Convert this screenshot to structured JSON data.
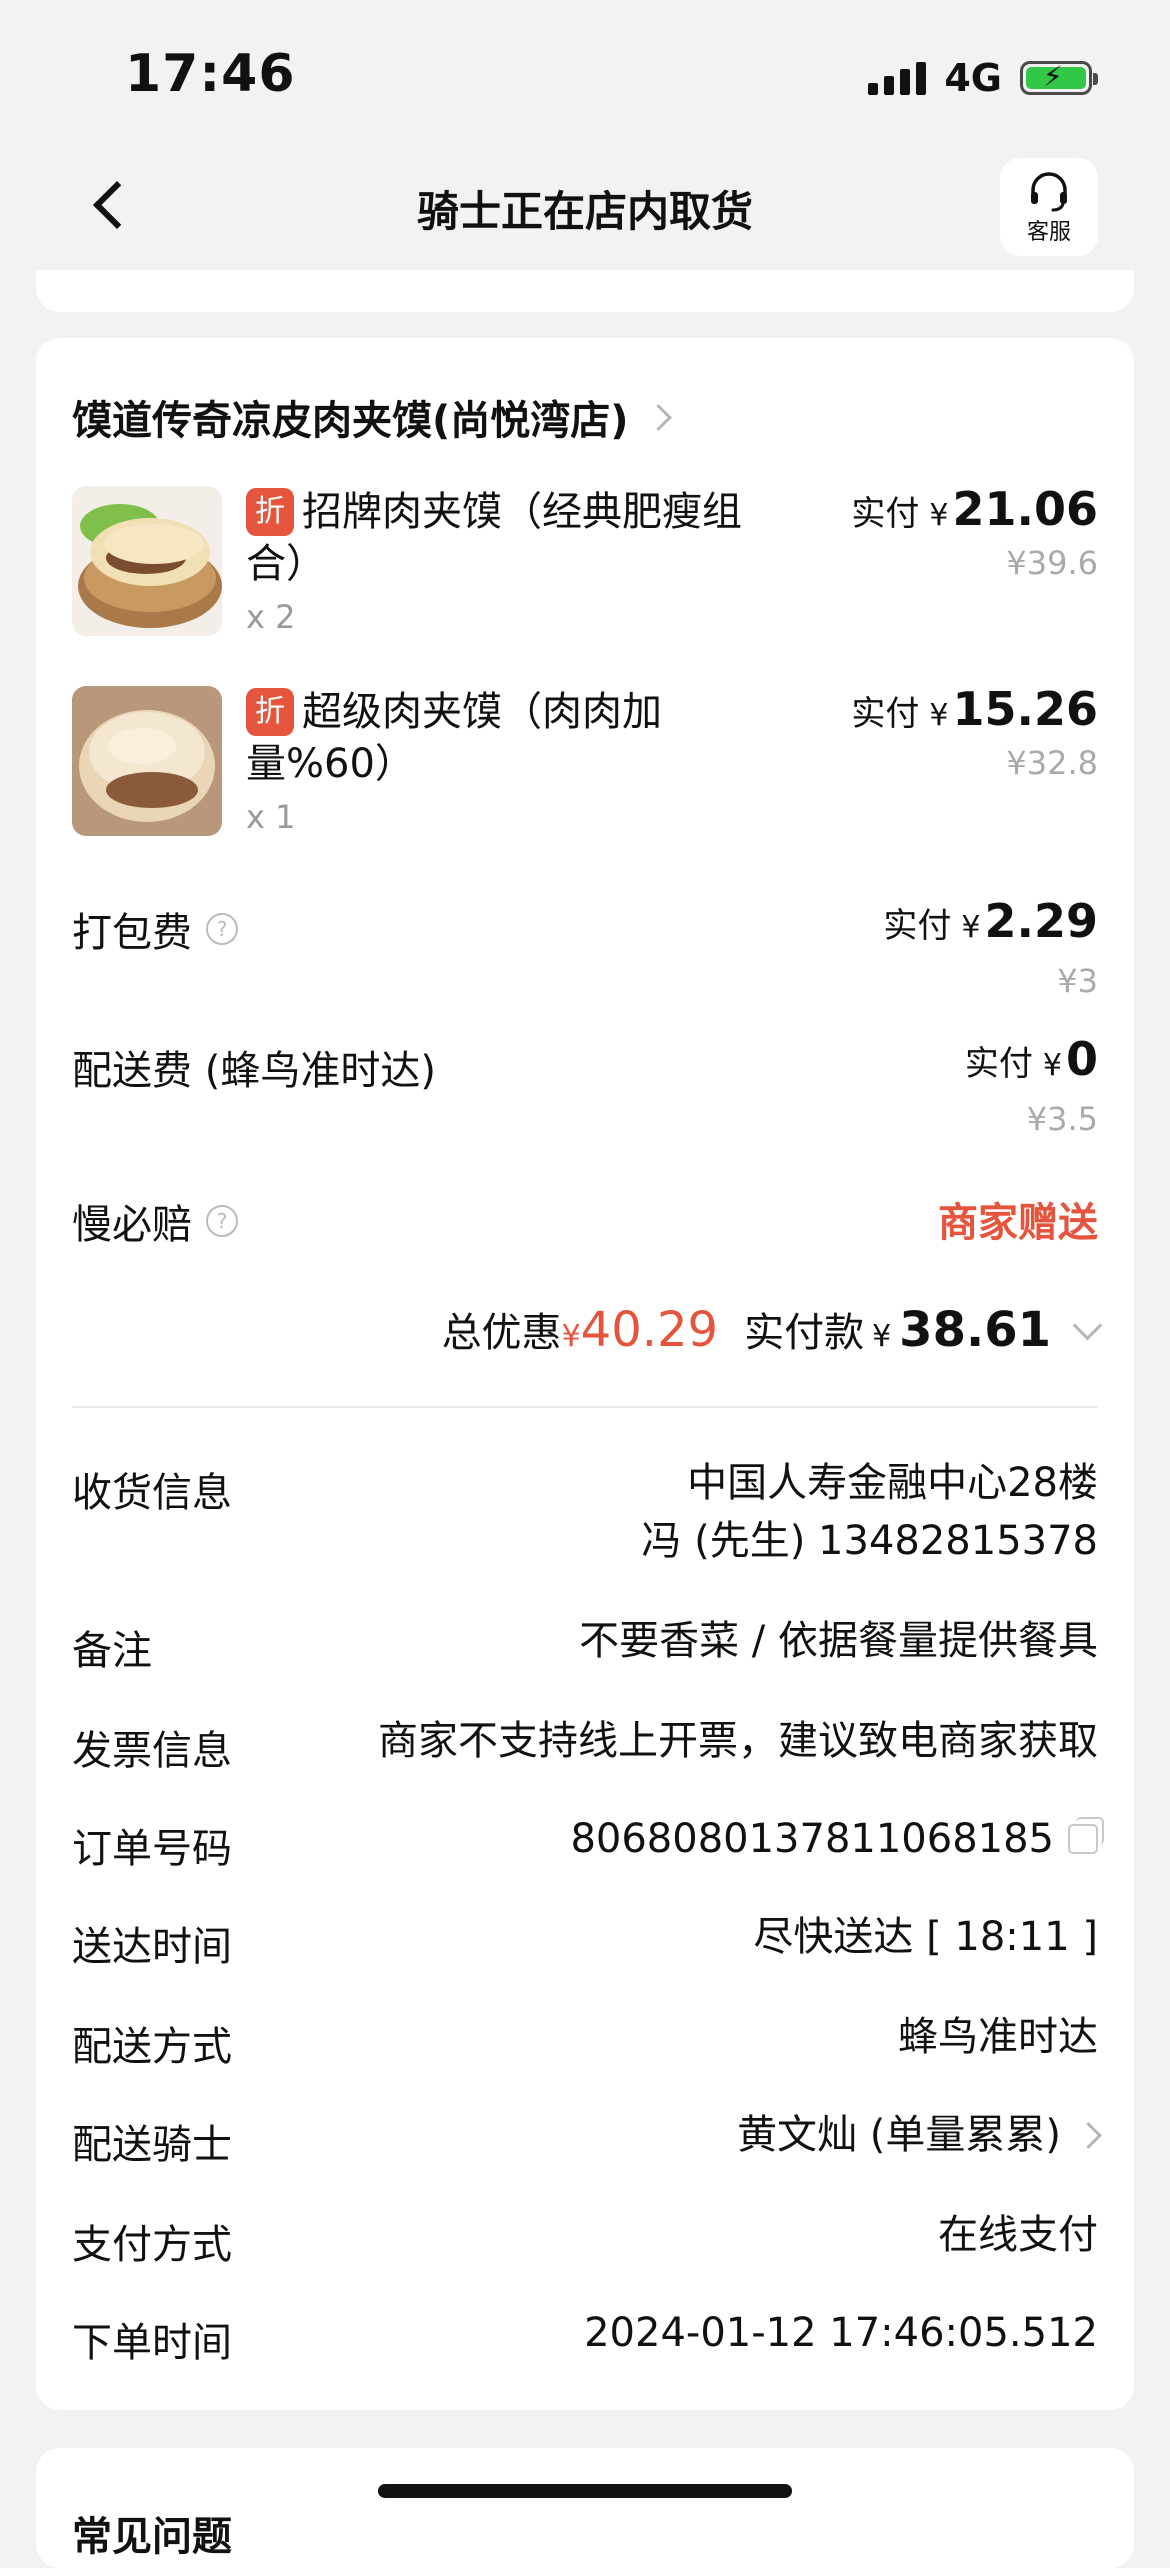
{
  "status": {
    "time": "17:46",
    "network": "4G"
  },
  "nav": {
    "title": "骑士正在店内取货",
    "service_label": "客服"
  },
  "store": {
    "name": "馍道传奇凉皮肉夹馍(尚悦湾店)"
  },
  "items": [
    {
      "tag": "折",
      "name": "招牌肉夹馍（经典肥瘦组合）",
      "qty": "x 2",
      "paid_label": "实付",
      "yen": "¥",
      "price": "21.06",
      "original": "¥39.6"
    },
    {
      "tag": "折",
      "name": "超级肉夹馍（肉肉加量%60）",
      "qty": "x 1",
      "paid_label": "实付",
      "yen": "¥",
      "price": "15.26",
      "original": "¥32.8"
    }
  ],
  "fees": {
    "packing": {
      "label": "打包费",
      "help": "?",
      "paid_label": "实付",
      "yen": "¥",
      "price": "2.29",
      "original": "¥3"
    },
    "delivery": {
      "label": "配送费 (蜂鸟准时达)",
      "paid_label": "实付",
      "yen": "¥",
      "price": "0",
      "original": "¥3.5"
    },
    "slow_comp": {
      "label": "慢必赔",
      "help": "?",
      "value": "商家赠送"
    }
  },
  "totals": {
    "discount_label": "总优惠",
    "discount_yen": "¥",
    "discount": "40.29",
    "paid_label": "实付款",
    "paid_yen": "¥",
    "paid": "38.61"
  },
  "info": {
    "receiver": {
      "label": "收货信息",
      "address": "中国人寿金融中心28楼",
      "contact": "冯 (先生) 13482815378"
    },
    "remark": {
      "label": "备注",
      "value": "不要香菜 / 依据餐量提供餐具"
    },
    "invoice": {
      "label": "发票信息",
      "value": "商家不支持线上开票，建议致电商家获取"
    },
    "order_no": {
      "label": "订单号码",
      "value": "8068080137811068185"
    },
    "delivery_time": {
      "label": "送达时间",
      "value": "尽快送达 [ 18:11 ]"
    },
    "delivery_method": {
      "label": "配送方式",
      "value": "蜂鸟准时达"
    },
    "rider": {
      "label": "配送骑士",
      "value": "黄文灿 (单量累累)"
    },
    "payment": {
      "label": "支付方式",
      "value": "在线支付"
    },
    "order_time": {
      "label": "下单时间",
      "value": "2024-01-12 17:46:05.512"
    }
  },
  "faq": {
    "title": "常见问题"
  },
  "colors": {
    "accent_red": "#e5543c",
    "battery_green": "#33c748",
    "background": "#f2f2f2"
  }
}
